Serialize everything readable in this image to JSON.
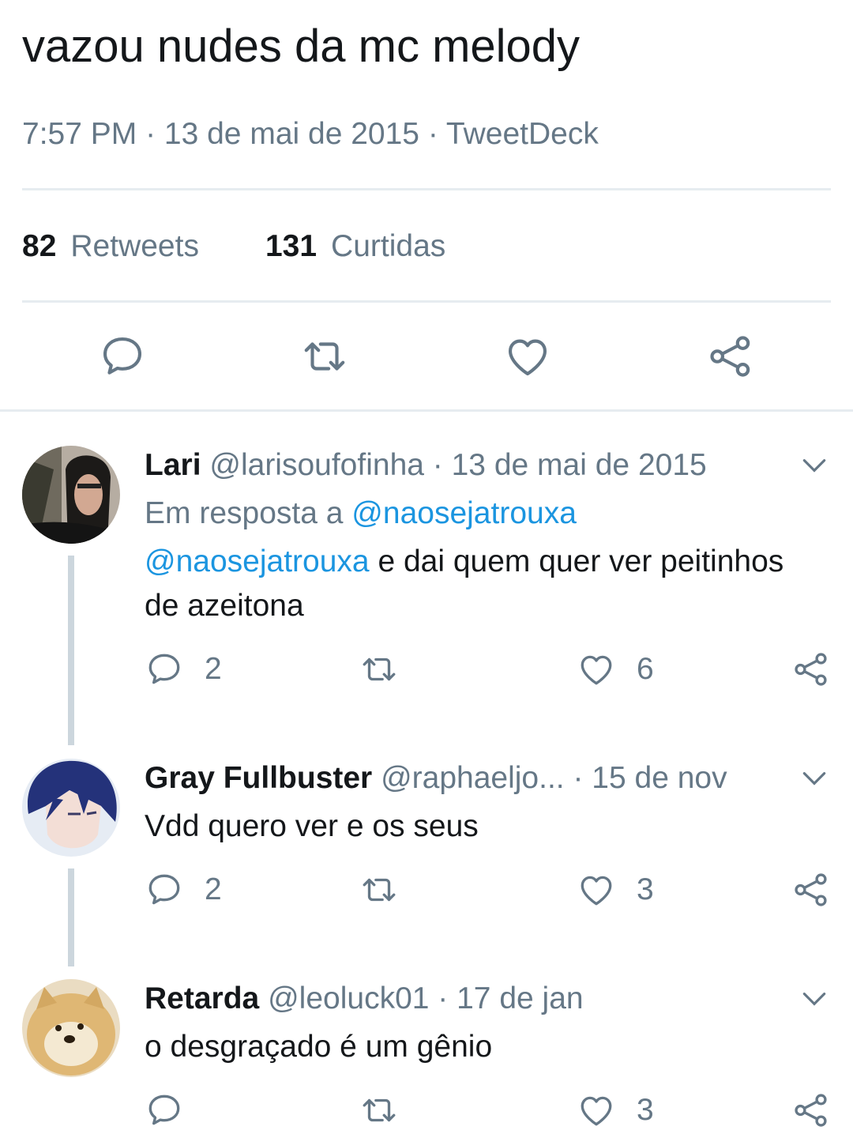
{
  "tweet": {
    "text": "vazou nudes da mc melody",
    "meta": "7:57 PM · 13 de mai de 2015 · TweetDeck",
    "retweets_count": "82",
    "retweets_label": "Retweets",
    "likes_count": "131",
    "likes_label": "Curtidas",
    "action_icons": [
      "reply-icon",
      "retweet-icon",
      "like-icon",
      "share-icon"
    ]
  },
  "replies": [
    {
      "name": "Lari",
      "handle": "@larisoufofinha",
      "date": "· 13 de mai de 2015",
      "in_reply_prefix": "Em resposta a",
      "in_reply_handle": "@naosejatrouxa",
      "mention": "@naosejatrouxa",
      "text": "e dai quem quer ver peitinhos",
      "text_cont": "de azeitona",
      "replies": "2",
      "likes": "6"
    },
    {
      "name": "Gray Fullbuster",
      "handle": "@raphaeljo...",
      "date": "· 15 de nov",
      "text": "Vdd quero ver e os seus",
      "replies": "2",
      "likes": "3"
    },
    {
      "name": "Retarda",
      "handle": "@leoluck01",
      "date": "· 17 de jan",
      "text": "o desgraçado é um gênio",
      "replies": "",
      "likes": "3"
    }
  ],
  "colors": {
    "text": "#14171a",
    "secondary": "#657786",
    "link": "#1b95e0",
    "divider": "#e6ecf0",
    "thread_line": "#ccd6dd"
  }
}
